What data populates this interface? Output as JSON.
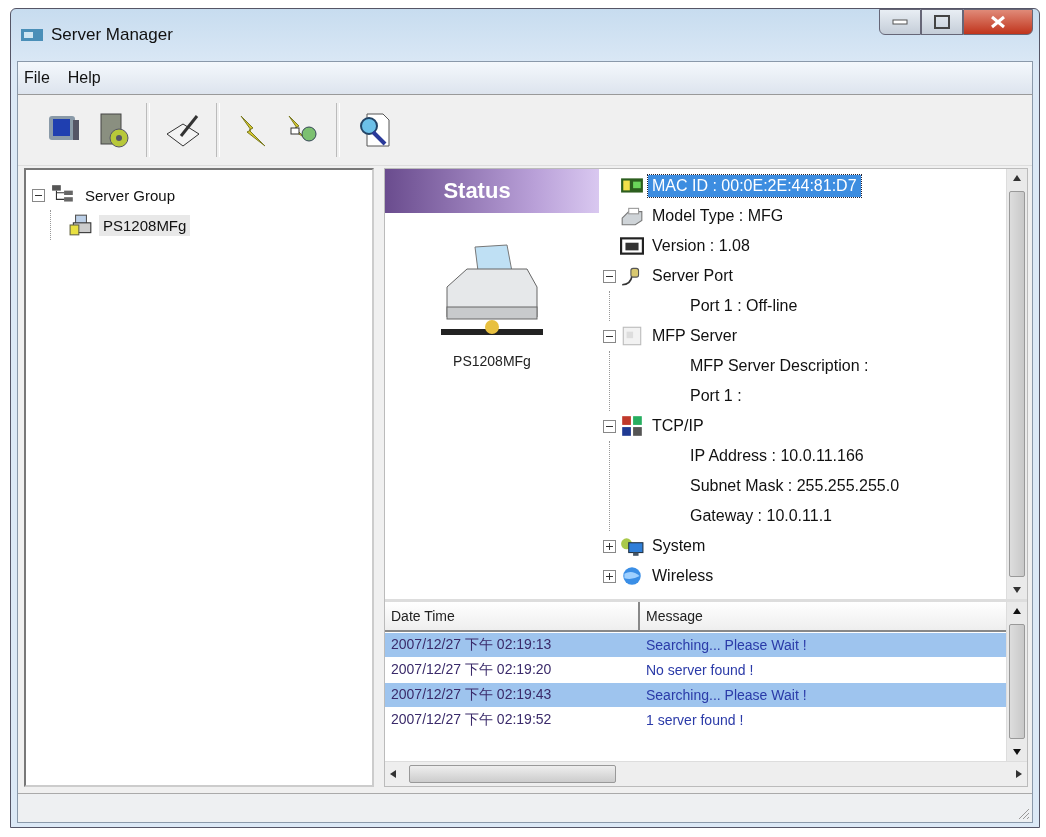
{
  "window": {
    "title": "Server Manager"
  },
  "menu": [
    {
      "label": "File"
    },
    {
      "label": "Help"
    }
  ],
  "server_tree": {
    "label": "Server Group",
    "expanded": true,
    "children": [
      {
        "label": "PS1208MFg",
        "selected": true
      }
    ]
  },
  "status_panel": {
    "header": "Status",
    "device_name": "PS1208MFg"
  },
  "device_tree": [
    {
      "label": "MAC ID : 00:0E:2E:44:81:D7",
      "kind": "mac",
      "selected": true
    },
    {
      "label": "Model Type : MFG",
      "kind": "model",
      "selected": false
    },
    {
      "label": "Version : 1.08",
      "kind": "version",
      "selected": false
    },
    {
      "label": "Server Port",
      "kind": "port",
      "selected": false,
      "expanded": true,
      "children": [
        {
          "label": "Port 1 : Off-line",
          "selected": false
        }
      ]
    },
    {
      "label": "MFP Server",
      "kind": "mfp",
      "selected": false,
      "expanded": true,
      "children": [
        {
          "label": "MFP Server Description :",
          "selected": false
        },
        {
          "label": "Port 1 :",
          "selected": false
        }
      ]
    },
    {
      "label": "TCP/IP",
      "kind": "tcpip",
      "selected": false,
      "expanded": true,
      "children": [
        {
          "label": "IP Address : 10.0.11.166",
          "selected": false
        },
        {
          "label": "Subnet Mask : 255.255.255.0",
          "selected": false
        },
        {
          "label": "Gateway : 10.0.11.1",
          "selected": false
        }
      ]
    },
    {
      "label": "System",
      "kind": "system",
      "selected": false,
      "expanded": false
    },
    {
      "label": "Wireless",
      "kind": "wireless",
      "selected": false,
      "expanded": false
    }
  ],
  "log": {
    "columns": [
      "Date Time",
      "Message"
    ],
    "rows": [
      {
        "date_time": "2007/12/27 下午 02:19:13",
        "message": "Searching... Please Wait !",
        "selected": true
      },
      {
        "date_time": "2007/12/27 下午 02:19:20",
        "message": "No server found !",
        "selected": false
      },
      {
        "date_time": "2007/12/27 下午 02:19:43",
        "message": "Searching... Please Wait !",
        "selected": true
      },
      {
        "date_time": "2007/12/27 下午 02:19:52",
        "message": "1 server found !",
        "selected": false
      }
    ]
  }
}
